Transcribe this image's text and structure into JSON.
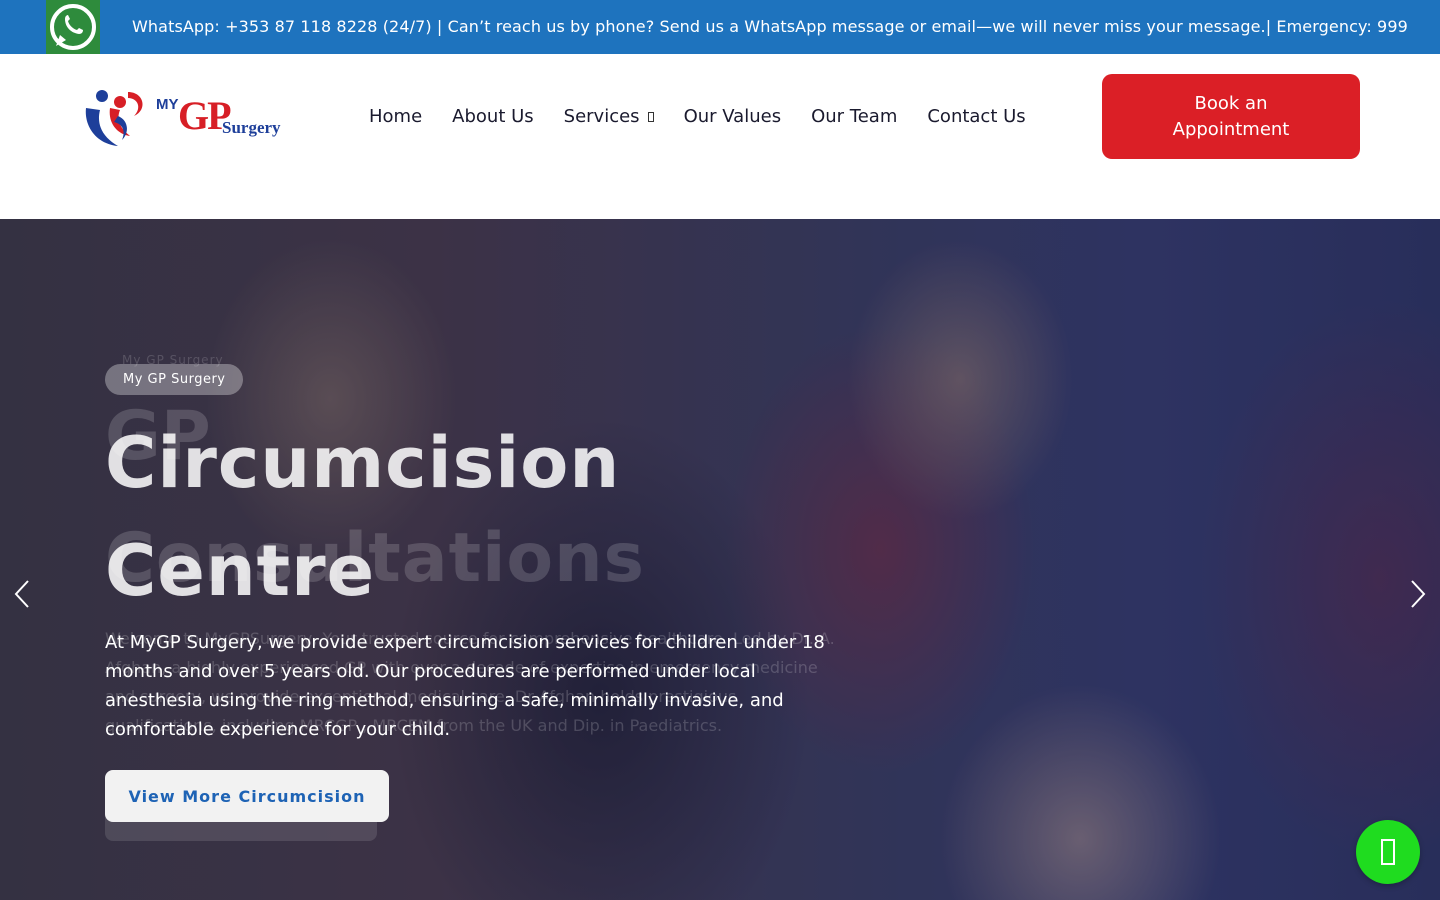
{
  "topbar": {
    "text": "WhatsApp: +353 87 118 8228 (24/7) | Can’t reach us by phone? Send us a WhatsApp message or email—we will never miss your message.| Emergency: 999",
    "icon": "whatsapp-icon"
  },
  "header": {
    "logo": {
      "my": "MY",
      "gp": "GP",
      "surgery": "Surgery"
    },
    "nav": [
      {
        "label": "Home"
      },
      {
        "label": "About Us"
      },
      {
        "label": "Services",
        "has_dropdown": true
      },
      {
        "label": "Our Values"
      },
      {
        "label": "Our Team"
      },
      {
        "label": "Contact Us"
      }
    ],
    "book_button": "Book an Appointment"
  },
  "hero": {
    "badge": "My GP Surgery",
    "title": "Circumcision Centre",
    "paragraph": "At MyGP Surgery, we provide expert circumcision services for children under 18 months and over 5 years old. Our procedures are performed under local anesthesia using the ring method, ensuring a safe, minimally invasive, and comfortable experience for your child.",
    "button": "View More Circumcision",
    "previous_slide": {
      "badge": "My GP Surgery",
      "title_line1": "GP",
      "title_line2": "Consultations",
      "paragraph": "Welcome to MyGPSurgery, Your trusted source for comprehensive healthcare. Led by Dr. A. Afghan, a highly experienced GP with over a decade of expertise in emergency medicine and surgery, we provide exceptional medical care. Dr Afghan holds prestigious qualifications, including MRCGP , MRCEM from the UK and Dip. in Paediatrics."
    }
  },
  "colors": {
    "topbar": "#1e73be",
    "book_button": "#db1f26",
    "whatsapp_float": "#1fdc1f",
    "brand_blue": "#1e3f9a",
    "brand_red": "#d71f26"
  }
}
